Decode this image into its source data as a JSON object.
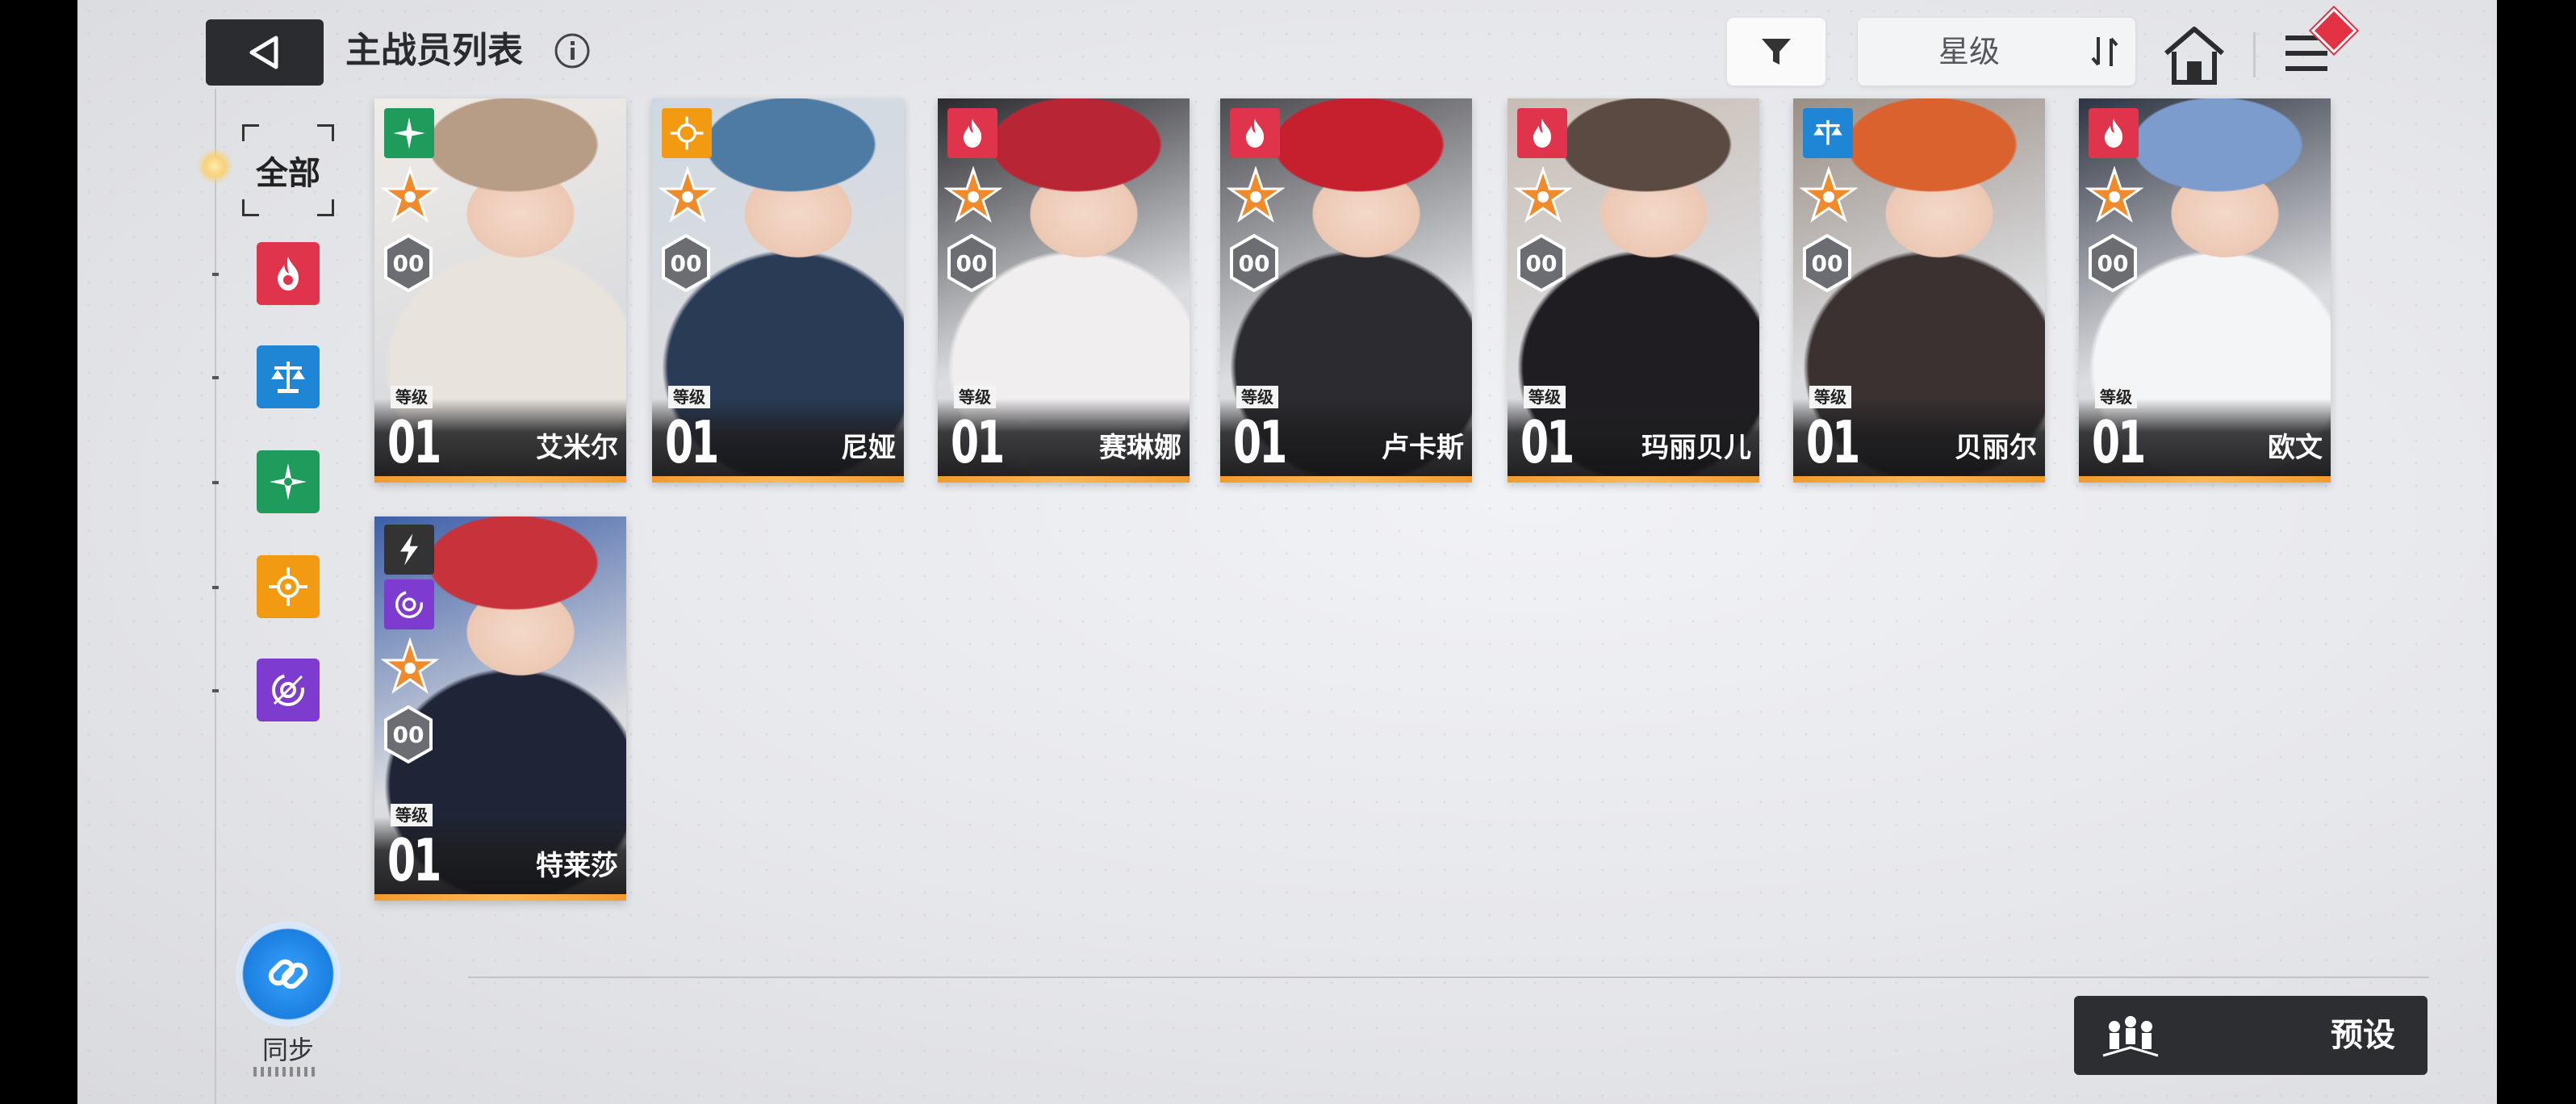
{
  "header": {
    "title": "主战员列表",
    "sort_label": "星级"
  },
  "sidebar": {
    "all_label": "全部",
    "elements": [
      {
        "name": "fire",
        "color": "#e0334c"
      },
      {
        "name": "balance",
        "color": "#1f86d6"
      },
      {
        "name": "wind",
        "color": "#1f9c5c"
      },
      {
        "name": "sun",
        "color": "#f29a12"
      },
      {
        "name": "void",
        "color": "#7d3ccf"
      }
    ],
    "sync_label": "同步"
  },
  "cards": [
    {
      "name": "艾米尔",
      "level_label": "等级",
      "level": "01",
      "rank": "00",
      "element_color": "#1f9c5c",
      "element": "wind",
      "art": [
        "#e8e3dc",
        "#b89d86",
        "#f0ece6"
      ]
    },
    {
      "name": "尼娅",
      "level_label": "等级",
      "level": "01",
      "rank": "00",
      "element_color": "#f29a12",
      "element": "sun",
      "art": [
        "#2a3b56",
        "#4d7ba3",
        "#cfd8e2"
      ]
    },
    {
      "name": "赛琳娜",
      "level_label": "等级",
      "level": "01",
      "rank": "00",
      "element_color": "#e0334c",
      "element": "fire",
      "art": [
        "#f1eef0",
        "#b82636",
        "#2a2a2e"
      ]
    },
    {
      "name": "卢卡斯",
      "level_label": "等级",
      "level": "01",
      "rank": "00",
      "element_color": "#e0334c",
      "element": "fire",
      "art": [
        "#2c2c30",
        "#c6202f",
        "#4b4b50"
      ]
    },
    {
      "name": "玛丽贝儿",
      "level_label": "等级",
      "level": "01",
      "rank": "00",
      "element_color": "#e0334c",
      "element": "fire",
      "art": [
        "#1f1d22",
        "#5a4a42",
        "#c8bdb4"
      ]
    },
    {
      "name": "贝丽尔",
      "level_label": "等级",
      "level": "01",
      "rank": "00",
      "element_color": "#1f86d6",
      "element": "balance",
      "art": [
        "#3a3130",
        "#d9622f",
        "#9a8f86"
      ]
    },
    {
      "name": "欧文",
      "level_label": "等级",
      "level": "01",
      "rank": "00",
      "element_color": "#e0334c",
      "element": "fire",
      "art": [
        "#f4f5f7",
        "#7b9ccc",
        "#2e3442"
      ]
    },
    {
      "name": "特莱莎",
      "level_label": "等级",
      "level": "01",
      "rank": "00",
      "element_color": "#7d3ccf",
      "element": "void",
      "extra_element": "lightning",
      "art": [
        "#1f2536",
        "#c8323a",
        "#3d5fa8"
      ]
    }
  ],
  "footer": {
    "preset_label": "预设"
  }
}
